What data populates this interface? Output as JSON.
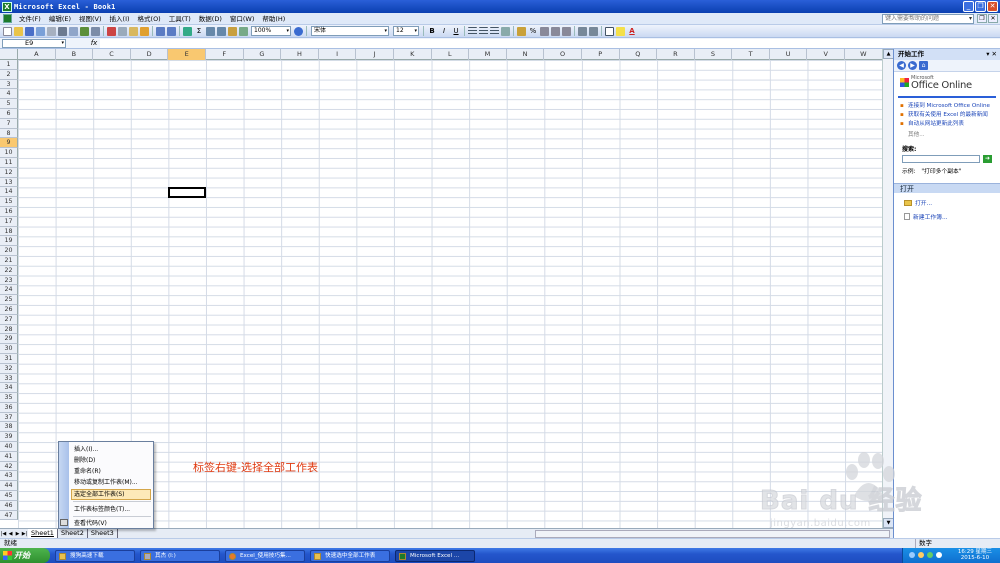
{
  "window": {
    "title": "Microsoft Excel - Book1",
    "icon": "excel-icon"
  },
  "menubar": {
    "items": [
      "文件(F)",
      "编辑(E)",
      "视图(V)",
      "插入(I)",
      "格式(O)",
      "工具(T)",
      "数据(D)",
      "窗口(W)",
      "帮助(H)"
    ],
    "help_placeholder": "键入需要帮助的问题"
  },
  "toolbar": {
    "zoom": "100%",
    "font": "宋体",
    "size": "12",
    "bold": "B",
    "italic": "I",
    "underline": "U"
  },
  "formulabar": {
    "cell_ref": "E9",
    "fx": "fx",
    "content": ""
  },
  "grid": {
    "columns": [
      "A",
      "B",
      "C",
      "D",
      "E",
      "F",
      "G",
      "H",
      "I",
      "J",
      "K",
      "L",
      "M",
      "N",
      "O",
      "P",
      "Q",
      "R",
      "S",
      "T",
      "U",
      "V",
      "W"
    ],
    "selected_column": "E",
    "selected_row": 9,
    "rows": [
      1,
      2,
      3,
      4,
      5,
      6,
      7,
      8,
      9,
      10,
      11,
      12,
      13,
      14,
      15,
      16,
      17,
      18,
      19,
      20,
      21,
      22,
      23,
      24,
      25,
      26,
      27,
      28,
      29,
      30,
      31,
      32,
      33,
      34,
      35,
      36,
      37,
      38,
      39,
      40,
      41,
      42,
      43,
      44,
      45,
      46,
      47
    ]
  },
  "sheets": {
    "tabs": [
      "Sheet1",
      "Sheet2",
      "Sheet3"
    ],
    "active": "Sheet1"
  },
  "context_menu": {
    "items": [
      "插入(I)...",
      "删除(D)",
      "重命名(R)",
      "移动或复制工作表(M)...",
      "选定全部工作表(S)",
      "工作表标签颜色(T)...",
      "查看代码(V)"
    ],
    "highlighted": "选定全部工作表(S)"
  },
  "annotation": "标签右键-选择全部工作表",
  "status": {
    "left": "就绪",
    "numlock": "数字"
  },
  "taskpane": {
    "title": "开始工作",
    "office_small": "Microsoft",
    "office_big": "Office Online",
    "links": [
      "连接到 Microsoft Office Online",
      "获取有关使用 Excel 的最新新闻",
      "自动从网站更新此列表"
    ],
    "more": "其他...",
    "search_label": "搜索:",
    "example_label": "示例:",
    "example_value": "\"打印多个副本\"",
    "open_heading": "打开",
    "open_item": "打开...",
    "new_item": "新建工作簿..."
  },
  "taskbar": {
    "start": "开始",
    "tasks": [
      "搜狗高速下载",
      "其杰 (I:)",
      "Excel_使用技巧集...",
      "快速选中全部工作表",
      "Microsoft Excel ..."
    ],
    "active_task": "Microsoft Excel ...",
    "time": "16:29 星期三",
    "date": "2015-6-10"
  },
  "watermark": {
    "text": "Bai du 经验",
    "url": "jingyan.baidu.com"
  }
}
